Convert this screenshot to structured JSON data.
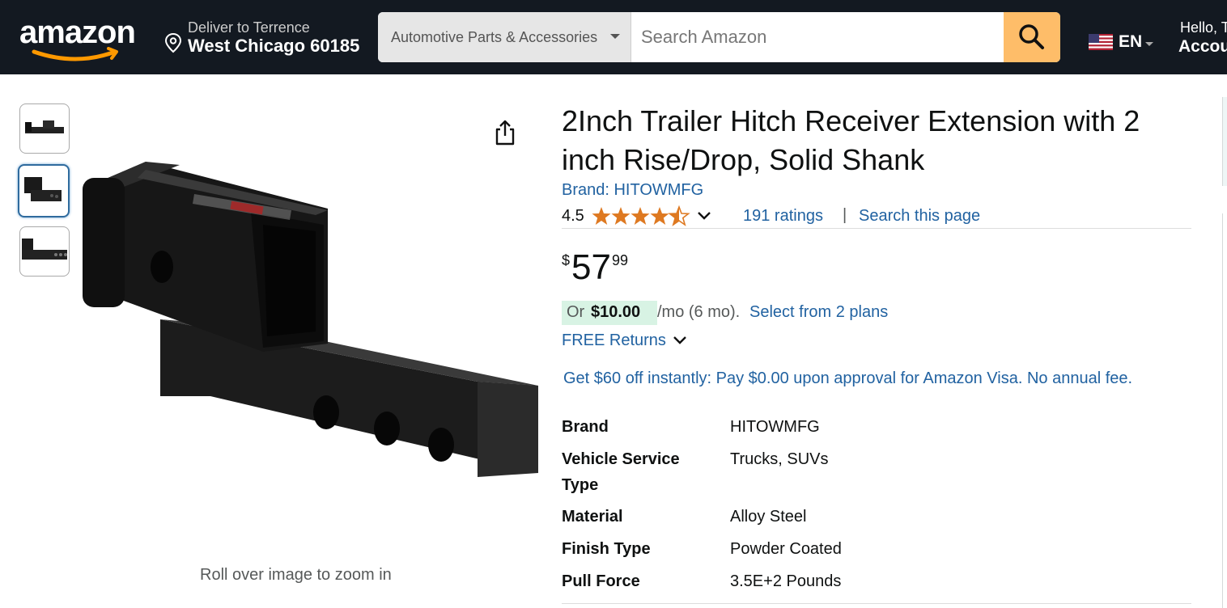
{
  "header": {
    "logo_text": "amazon",
    "deliver_line1": "Deliver to Terrence",
    "deliver_line2": "West Chicago 60185",
    "search_category": "Automotive Parts & Accessories",
    "search_placeholder": "Search Amazon",
    "language": "EN",
    "account_line1": "Hello, T",
    "account_line2": "Accou",
    "colors": {
      "bar": "#131921",
      "search_button": "#febd69"
    }
  },
  "gallery": {
    "thumbnails": [
      "thumb-1",
      "thumb-2",
      "thumb-3"
    ],
    "selected_index": 1,
    "zoom_hint": "Roll over image to zoom in"
  },
  "product": {
    "title": "2Inch Trailer Hitch Receiver Extension with 2 inch Rise/Drop, Solid Shank",
    "brand_link": "Brand: HITOWMFG",
    "rating_value": "4.5",
    "rating_stars": 4.5,
    "ratings_count": "191 ratings",
    "separator": "|",
    "search_page": "Search this page",
    "price": {
      "symbol": "$",
      "whole": "57",
      "fraction": "99"
    },
    "installment": {
      "prefix": "Or",
      "amount": "$10.00",
      "term": "/mo (6 mo).",
      "link": "Select from 2 plans"
    },
    "returns": "FREE Returns",
    "promo": "Get $60 off instantly: Pay $0.00 upon approval for Amazon Visa. No annual fee.",
    "specs": [
      {
        "label": "Brand",
        "value": "HITOWMFG"
      },
      {
        "label": "Vehicle Service Type",
        "value": "Trucks, SUVs"
      },
      {
        "label": "Material",
        "value": "Alloy Steel"
      },
      {
        "label": "Finish Type",
        "value": "Powder Coated"
      },
      {
        "label": "Pull Force",
        "value": "3.5E+2 Pounds"
      }
    ],
    "colors": {
      "link": "#2162a1",
      "star": "#de7921",
      "installment_highlight": "#d8f3e4"
    }
  }
}
